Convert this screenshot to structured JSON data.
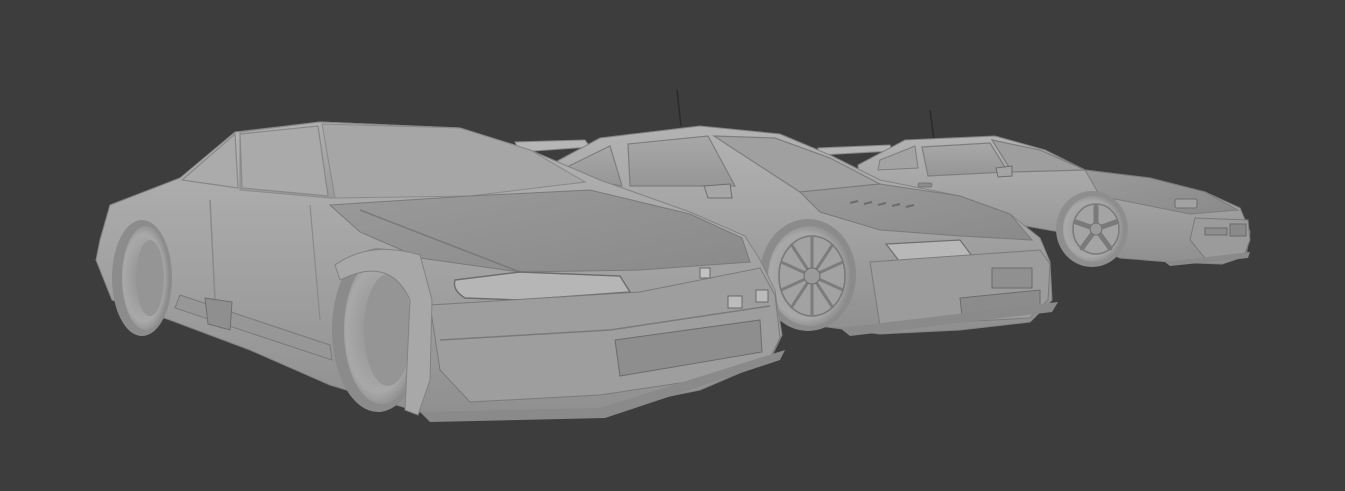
{
  "viewport": {
    "background": "#3d3d3d",
    "shading": "solid-gray",
    "model_color": "#a6a6a6"
  },
  "scene": {
    "objects": [
      {
        "kind": "car-model",
        "icon": "wide-body-coupe"
      },
      {
        "kind": "car-model",
        "icon": "touring-sedan"
      },
      {
        "kind": "car-model",
        "icon": "pop-up-headlight-coupe"
      }
    ]
  }
}
